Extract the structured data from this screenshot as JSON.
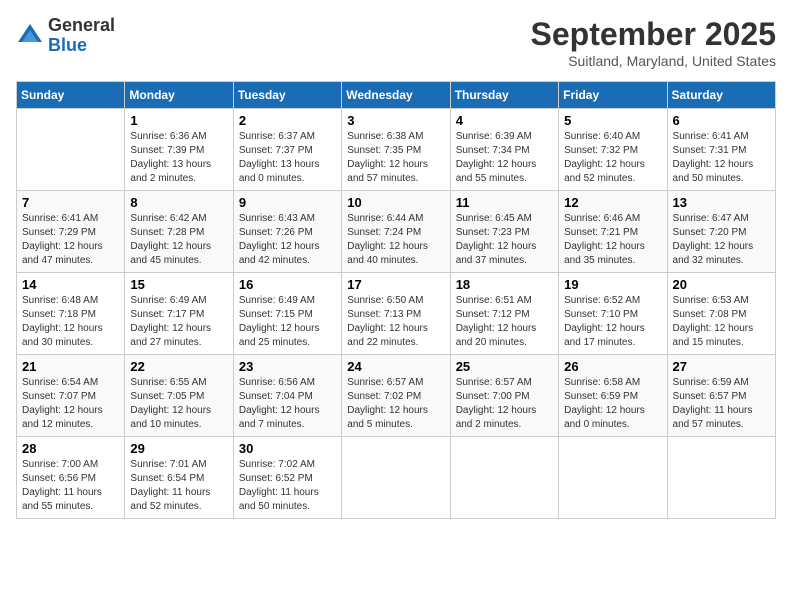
{
  "logo": {
    "general": "General",
    "blue": "Blue"
  },
  "header": {
    "month": "September 2025",
    "location": "Suitland, Maryland, United States"
  },
  "weekdays": [
    "Sunday",
    "Monday",
    "Tuesday",
    "Wednesday",
    "Thursday",
    "Friday",
    "Saturday"
  ],
  "weeks": [
    [
      {
        "day": "",
        "sunrise": "",
        "sunset": "",
        "daylight": ""
      },
      {
        "day": "1",
        "sunrise": "Sunrise: 6:36 AM",
        "sunset": "Sunset: 7:39 PM",
        "daylight": "Daylight: 13 hours and 2 minutes."
      },
      {
        "day": "2",
        "sunrise": "Sunrise: 6:37 AM",
        "sunset": "Sunset: 7:37 PM",
        "daylight": "Daylight: 13 hours and 0 minutes."
      },
      {
        "day": "3",
        "sunrise": "Sunrise: 6:38 AM",
        "sunset": "Sunset: 7:35 PM",
        "daylight": "Daylight: 12 hours and 57 minutes."
      },
      {
        "day": "4",
        "sunrise": "Sunrise: 6:39 AM",
        "sunset": "Sunset: 7:34 PM",
        "daylight": "Daylight: 12 hours and 55 minutes."
      },
      {
        "day": "5",
        "sunrise": "Sunrise: 6:40 AM",
        "sunset": "Sunset: 7:32 PM",
        "daylight": "Daylight: 12 hours and 52 minutes."
      },
      {
        "day": "6",
        "sunrise": "Sunrise: 6:41 AM",
        "sunset": "Sunset: 7:31 PM",
        "daylight": "Daylight: 12 hours and 50 minutes."
      }
    ],
    [
      {
        "day": "7",
        "sunrise": "Sunrise: 6:41 AM",
        "sunset": "Sunset: 7:29 PM",
        "daylight": "Daylight: 12 hours and 47 minutes."
      },
      {
        "day": "8",
        "sunrise": "Sunrise: 6:42 AM",
        "sunset": "Sunset: 7:28 PM",
        "daylight": "Daylight: 12 hours and 45 minutes."
      },
      {
        "day": "9",
        "sunrise": "Sunrise: 6:43 AM",
        "sunset": "Sunset: 7:26 PM",
        "daylight": "Daylight: 12 hours and 42 minutes."
      },
      {
        "day": "10",
        "sunrise": "Sunrise: 6:44 AM",
        "sunset": "Sunset: 7:24 PM",
        "daylight": "Daylight: 12 hours and 40 minutes."
      },
      {
        "day": "11",
        "sunrise": "Sunrise: 6:45 AM",
        "sunset": "Sunset: 7:23 PM",
        "daylight": "Daylight: 12 hours and 37 minutes."
      },
      {
        "day": "12",
        "sunrise": "Sunrise: 6:46 AM",
        "sunset": "Sunset: 7:21 PM",
        "daylight": "Daylight: 12 hours and 35 minutes."
      },
      {
        "day": "13",
        "sunrise": "Sunrise: 6:47 AM",
        "sunset": "Sunset: 7:20 PM",
        "daylight": "Daylight: 12 hours and 32 minutes."
      }
    ],
    [
      {
        "day": "14",
        "sunrise": "Sunrise: 6:48 AM",
        "sunset": "Sunset: 7:18 PM",
        "daylight": "Daylight: 12 hours and 30 minutes."
      },
      {
        "day": "15",
        "sunrise": "Sunrise: 6:49 AM",
        "sunset": "Sunset: 7:17 PM",
        "daylight": "Daylight: 12 hours and 27 minutes."
      },
      {
        "day": "16",
        "sunrise": "Sunrise: 6:49 AM",
        "sunset": "Sunset: 7:15 PM",
        "daylight": "Daylight: 12 hours and 25 minutes."
      },
      {
        "day": "17",
        "sunrise": "Sunrise: 6:50 AM",
        "sunset": "Sunset: 7:13 PM",
        "daylight": "Daylight: 12 hours and 22 minutes."
      },
      {
        "day": "18",
        "sunrise": "Sunrise: 6:51 AM",
        "sunset": "Sunset: 7:12 PM",
        "daylight": "Daylight: 12 hours and 20 minutes."
      },
      {
        "day": "19",
        "sunrise": "Sunrise: 6:52 AM",
        "sunset": "Sunset: 7:10 PM",
        "daylight": "Daylight: 12 hours and 17 minutes."
      },
      {
        "day": "20",
        "sunrise": "Sunrise: 6:53 AM",
        "sunset": "Sunset: 7:08 PM",
        "daylight": "Daylight: 12 hours and 15 minutes."
      }
    ],
    [
      {
        "day": "21",
        "sunrise": "Sunrise: 6:54 AM",
        "sunset": "Sunset: 7:07 PM",
        "daylight": "Daylight: 12 hours and 12 minutes."
      },
      {
        "day": "22",
        "sunrise": "Sunrise: 6:55 AM",
        "sunset": "Sunset: 7:05 PM",
        "daylight": "Daylight: 12 hours and 10 minutes."
      },
      {
        "day": "23",
        "sunrise": "Sunrise: 6:56 AM",
        "sunset": "Sunset: 7:04 PM",
        "daylight": "Daylight: 12 hours and 7 minutes."
      },
      {
        "day": "24",
        "sunrise": "Sunrise: 6:57 AM",
        "sunset": "Sunset: 7:02 PM",
        "daylight": "Daylight: 12 hours and 5 minutes."
      },
      {
        "day": "25",
        "sunrise": "Sunrise: 6:57 AM",
        "sunset": "Sunset: 7:00 PM",
        "daylight": "Daylight: 12 hours and 2 minutes."
      },
      {
        "day": "26",
        "sunrise": "Sunrise: 6:58 AM",
        "sunset": "Sunset: 6:59 PM",
        "daylight": "Daylight: 12 hours and 0 minutes."
      },
      {
        "day": "27",
        "sunrise": "Sunrise: 6:59 AM",
        "sunset": "Sunset: 6:57 PM",
        "daylight": "Daylight: 11 hours and 57 minutes."
      }
    ],
    [
      {
        "day": "28",
        "sunrise": "Sunrise: 7:00 AM",
        "sunset": "Sunset: 6:56 PM",
        "daylight": "Daylight: 11 hours and 55 minutes."
      },
      {
        "day": "29",
        "sunrise": "Sunrise: 7:01 AM",
        "sunset": "Sunset: 6:54 PM",
        "daylight": "Daylight: 11 hours and 52 minutes."
      },
      {
        "day": "30",
        "sunrise": "Sunrise: 7:02 AM",
        "sunset": "Sunset: 6:52 PM",
        "daylight": "Daylight: 11 hours and 50 minutes."
      },
      {
        "day": "",
        "sunrise": "",
        "sunset": "",
        "daylight": ""
      },
      {
        "day": "",
        "sunrise": "",
        "sunset": "",
        "daylight": ""
      },
      {
        "day": "",
        "sunrise": "",
        "sunset": "",
        "daylight": ""
      },
      {
        "day": "",
        "sunrise": "",
        "sunset": "",
        "daylight": ""
      }
    ]
  ]
}
